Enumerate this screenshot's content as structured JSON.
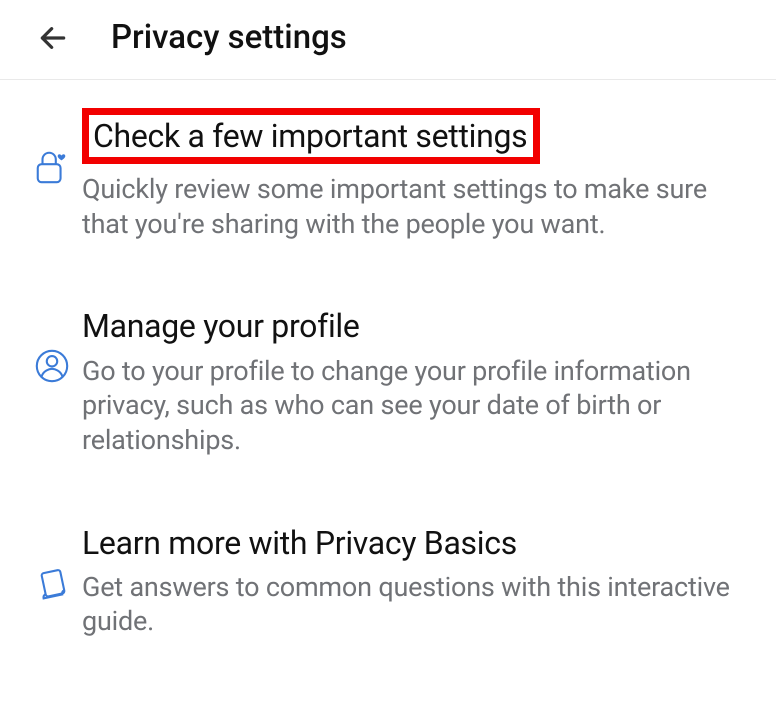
{
  "header": {
    "title": "Privacy settings"
  },
  "items": [
    {
      "title": "Check a few important settings",
      "desc": "Quickly review some important settings to make sure that you're sharing with the people you want."
    },
    {
      "title": "Manage your profile",
      "desc": "Go to your profile to change your profile information privacy, such as who can see your date of birth or relationships."
    },
    {
      "title": "Learn more with Privacy Basics",
      "desc": "Get answers to common questions with this interactive guide."
    }
  ]
}
